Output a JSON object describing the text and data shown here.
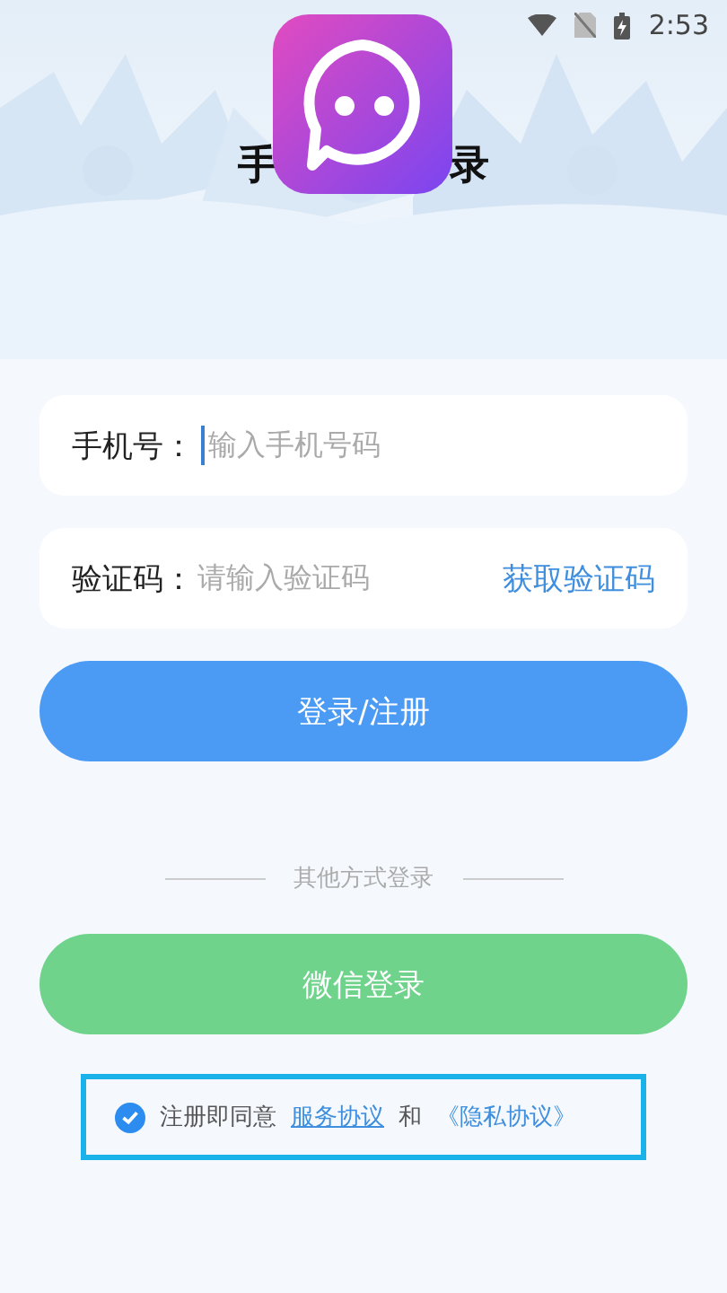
{
  "status_bar": {
    "time": "2:53"
  },
  "header": {
    "title_parts": [
      "手",
      "录"
    ]
  },
  "fields": [
    {
      "label": "手机号：",
      "placeholder": "输入手机号码",
      "focused": true
    },
    {
      "label": "验证码：",
      "placeholder": "请输入验证码",
      "action": "获取验证码",
      "focused": false
    }
  ],
  "login_button": "登录/注册",
  "divider_text": "其他方式登录",
  "wechat_button": "微信登录",
  "agreement": {
    "checked": true,
    "text": "注册即同意",
    "link1": "服务协议",
    "joiner": "和",
    "link2": "《隐私协议》"
  }
}
